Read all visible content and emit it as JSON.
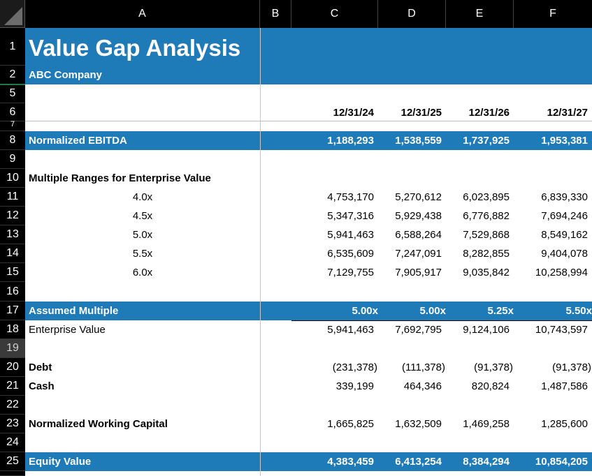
{
  "columns": [
    "A",
    "B",
    "C",
    "D",
    "E",
    "F"
  ],
  "rows": [
    "1",
    "2",
    "5",
    "6",
    "7",
    "8",
    "9",
    "10",
    "11",
    "12",
    "13",
    "14",
    "15",
    "16",
    "17",
    "18",
    "19",
    "20",
    "21",
    "22",
    "23",
    "24",
    "25"
  ],
  "title": "Value Gap Analysis",
  "company": "ABC Company",
  "dates": [
    "12/31/24",
    "12/31/25",
    "12/31/26",
    "12/31/27"
  ],
  "ebitda": {
    "label": "Normalized EBITDA",
    "values": [
      "1,188,293",
      "1,538,559",
      "1,737,925",
      "1,953,381"
    ]
  },
  "multiple_ranges": {
    "label": "Multiple Ranges for Enterprise Value",
    "rows": [
      {
        "multiple": "4.0x",
        "values": [
          "4,753,170",
          "5,270,612",
          "6,023,895",
          "6,839,330"
        ]
      },
      {
        "multiple": "4.5x",
        "values": [
          "5,347,316",
          "5,929,438",
          "6,776,882",
          "7,694,246"
        ]
      },
      {
        "multiple": "5.0x",
        "values": [
          "5,941,463",
          "6,588,264",
          "7,529,868",
          "8,549,162"
        ]
      },
      {
        "multiple": "5.5x",
        "values": [
          "6,535,609",
          "7,247,091",
          "8,282,855",
          "9,404,078"
        ]
      },
      {
        "multiple": "6.0x",
        "values": [
          "7,129,755",
          "7,905,917",
          "9,035,842",
          "10,258,994"
        ]
      }
    ]
  },
  "assumed_multiple": {
    "label": "Assumed Multiple",
    "values": [
      "5.00x",
      "5.00x",
      "5.25x",
      "5.50x"
    ]
  },
  "enterprise_value": {
    "label": "Enterprise Value",
    "values": [
      "5,941,463",
      "7,692,795",
      "9,124,106",
      "10,743,597"
    ]
  },
  "debt": {
    "label": "Debt",
    "values": [
      "(231,378)",
      "(111,378)",
      "(91,378)",
      "(91,378)"
    ]
  },
  "cash": {
    "label": "Cash",
    "values": [
      "339,199",
      "464,346",
      "820,824",
      "1,487,586"
    ]
  },
  "working_capital": {
    "label": "Normalized Working Capital",
    "values": [
      "1,665,825",
      "1,632,509",
      "1,469,258",
      "1,285,600"
    ]
  },
  "equity_value": {
    "label": "Equity Value",
    "values": [
      "4,383,459",
      "6,413,254",
      "8,384,294",
      "10,854,205"
    ]
  },
  "colors": {
    "band": "#1f7ab8",
    "header_bg": "#000000",
    "selected_row": "#3a3a3a"
  }
}
